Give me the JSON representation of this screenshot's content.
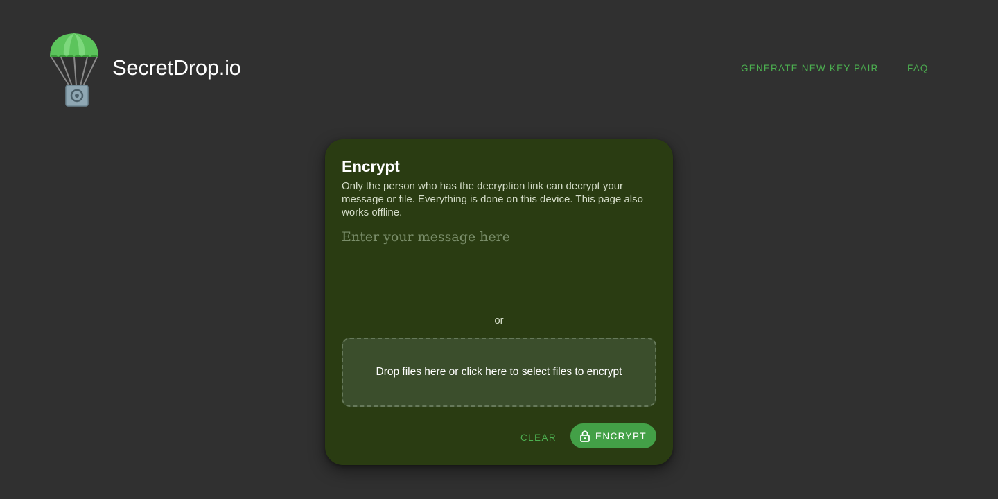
{
  "header": {
    "brand": "SecretDrop.io",
    "nav": {
      "generate_key_pair": "GENERATE NEW KEY PAIR",
      "faq": "FAQ"
    }
  },
  "card": {
    "title": "Encrypt",
    "description": "Only the person who has the decryption link can decrypt your message or file. Everything is done on this device. This page also works offline.",
    "message_placeholder": "Enter your message here",
    "message_value": "",
    "or_label": "or",
    "dropzone_label": "Drop files here or click here to select files to encrypt",
    "clear_label": "CLEAR",
    "encrypt_label": "ENCRYPT"
  },
  "icons": {
    "logo": "parachute-safe-logo",
    "encrypt": "lock-icon"
  },
  "colors": {
    "background": "#303030",
    "card": "#2a3c12",
    "accent": "#4caf50",
    "button": "#43a047",
    "dropzone": "#3b4e2c"
  }
}
